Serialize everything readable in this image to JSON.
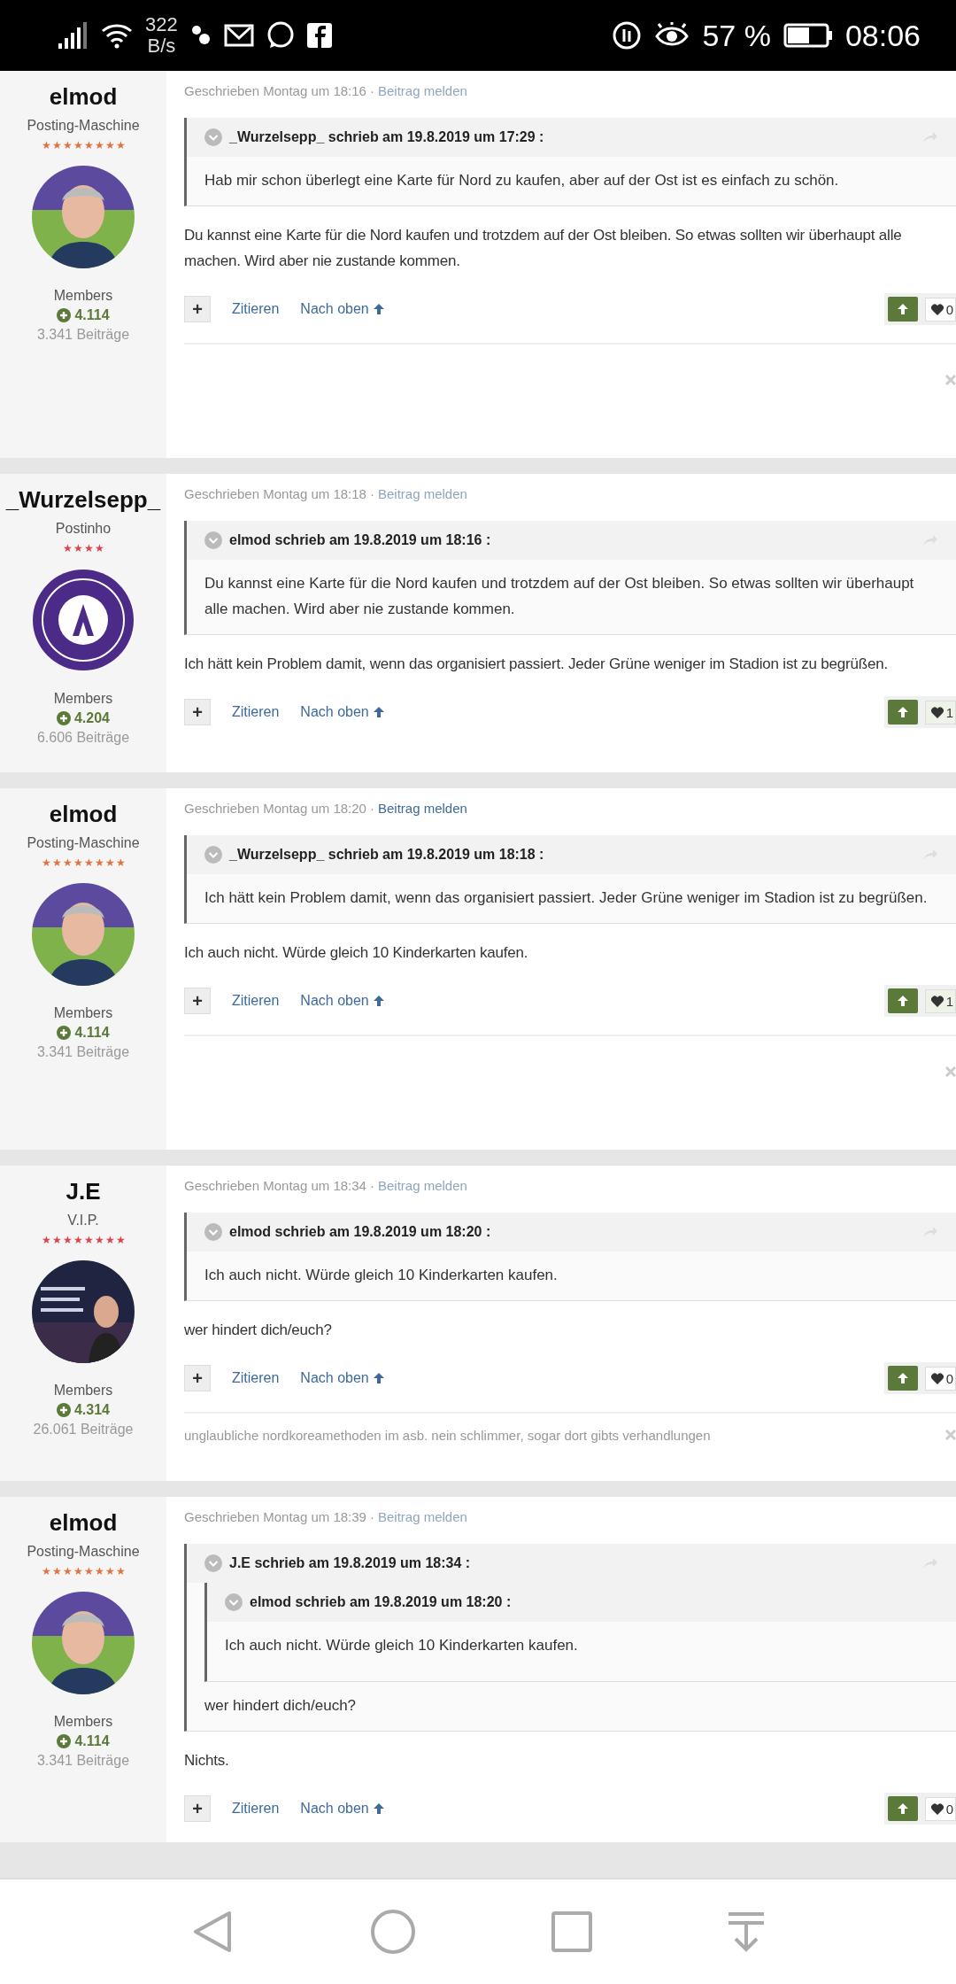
{
  "status_bar": {
    "speed": "322",
    "speed_unit": "B/s",
    "battery": "57 %",
    "time": "08:06"
  },
  "posts": [
    {
      "author": {
        "name": "elmod",
        "rank": "Posting-Maschine",
        "stars": 8,
        "color": "#e0703c",
        "avatar": {
          "kind": "portrait"
        },
        "group": "Members",
        "reputation": "4.114",
        "post_count": "3.341 Beiträge"
      },
      "meta": "Geschrieben Montag um 18:16",
      "separator": "·",
      "report": {
        "label": "Beitrag melden",
        "highlighted": false
      },
      "quote": {
        "header": "_Wurzelsepp_ schrieb am 19.8.2019 um 17:29 :",
        "body": "Hab mir schon überlegt eine Karte für Nord zu kaufen, aber auf der Ost ist es einfach zu schön."
      },
      "body": "Du kannst eine Karte für die Nord kaufen und trotzdem auf der Ost bleiben. So etwas sollten wir überhaupt alle machen. Wird aber nie zustande kommen.",
      "actions": {
        "more": "+",
        "quote": "Zitieren",
        "top": "Nach oben",
        "likes": "0",
        "liked": false
      },
      "signature": {
        "closable": true
      }
    },
    {
      "author": {
        "name": "_Wurzelsepp_",
        "rank": "Postinho",
        "stars": 4,
        "color": "#d9434b",
        "avatar": {
          "kind": "emblem"
        },
        "group": "Members",
        "reputation": "4.204",
        "post_count": "6.606 Beiträge"
      },
      "meta": "Geschrieben Montag um 18:18",
      "separator": "·",
      "report": {
        "label": "Beitrag melden",
        "highlighted": false
      },
      "quote": {
        "header": "elmod schrieb am 19.8.2019 um 18:16 :",
        "body": "Du kannst eine Karte für die Nord kaufen und trotzdem auf der Ost bleiben. So etwas sollten wir überhaupt alle machen. Wird aber nie zustande kommen."
      },
      "body": "Ich hätt kein Problem damit, wenn das organisiert passiert. Jeder Grüne weniger im Stadion ist zu begrüßen.",
      "actions": {
        "more": "+",
        "quote": "Zitieren",
        "top": "Nach oben",
        "likes": "1",
        "liked": true
      }
    },
    {
      "author": {
        "name": "elmod",
        "rank": "Posting-Maschine",
        "stars": 8,
        "color": "#e0703c",
        "avatar": {
          "kind": "portrait"
        },
        "group": "Members",
        "reputation": "4.114",
        "post_count": "3.341 Beiträge"
      },
      "meta": "Geschrieben Montag um 18:20",
      "separator": "·",
      "report": {
        "label": "Beitrag melden",
        "highlighted": true
      },
      "quote": {
        "header": "_Wurzelsepp_ schrieb am 19.8.2019 um 18:18 :",
        "body": "Ich hätt kein Problem damit, wenn das organisiert passiert. Jeder Grüne weniger im Stadion ist zu begrüßen."
      },
      "body": "Ich auch nicht. Würde gleich 10 Kinderkarten kaufen.",
      "actions": {
        "more": "+",
        "quote": "Zitieren",
        "top": "Nach oben",
        "likes": "1",
        "liked": true
      },
      "signature": {
        "closable": true
      }
    },
    {
      "author": {
        "name": "J.E",
        "rank": "V.I.P.",
        "stars": 8,
        "color": "#d9434b",
        "group": "Members",
        "reputation": "4.314",
        "post_count": "26.061 Beiträge"
      },
      "meta": "Geschrieben Montag um 18:34",
      "separator": "·",
      "report": {
        "label": "Beitrag melden",
        "highlighted": false
      },
      "quote": {
        "header": "elmod schrieb am 19.8.2019 um 18:20 :",
        "body": "Ich auch nicht. Würde gleich 10 Kinderkarten kaufen."
      },
      "body": "wer hindert dich/euch?",
      "actions": {
        "more": "+",
        "quote": "Zitieren",
        "top": "Nach oben",
        "likes": "0",
        "liked": false
      },
      "signature": {
        "closable": true,
        "text": "unglaubliche nordkoreamethoden im asb. nein schlimmer, sogar dort gibts verhandlungen"
      }
    },
    {
      "author": {
        "name": "elmod",
        "rank": "Posting-Maschine",
        "stars": 8,
        "color": "#e0703c",
        "avatar": {
          "kind": "portrait"
        },
        "group": "Members",
        "reputation": "4.114",
        "post_count": "3.341 Beiträge"
      },
      "meta": "Geschrieben Montag um 18:39",
      "separator": "·",
      "report": {
        "label": "Beitrag melden",
        "highlighted": false
      },
      "quote": {
        "header": "J.E schrieb am 19.8.2019 um 18:34 :",
        "nested": {
          "header": "elmod schrieb am 19.8.2019 um 18:20 :",
          "body": "Ich auch nicht. Würde gleich 10 Kinderkarten kaufen."
        },
        "body": "wer hindert dich/euch?"
      },
      "body": "Nichts.",
      "actions": {
        "more": "+",
        "quote": "Zitieren",
        "top": "Nach oben",
        "likes": "0",
        "liked": false
      }
    }
  ]
}
